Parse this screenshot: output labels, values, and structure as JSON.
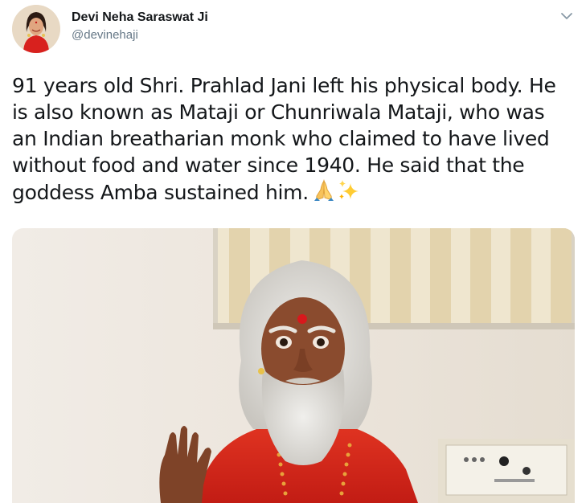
{
  "tweet": {
    "author": {
      "display_name": "Devi Neha Saraswat Ji",
      "handle": "@devinehaji",
      "avatar_icon": "profile-photo"
    },
    "caret_icon": "chevron-down-icon",
    "text_lines": [
      "91 years old Shri. Prahlad Jani left his physical body. He",
      "is also known as Mataji or Chunriwala Mataji, who was",
      "an Indian breatharian monk who claimed to have lived",
      "without food and water since 1940. He said that the",
      "goddess Amba sustained him."
    ],
    "emojis": [
      "folded-hands-icon",
      "sparkles-icon"
    ],
    "media": {
      "kind": "photo",
      "colors": {
        "wall": "#eee8e0",
        "robe": "#d9261c",
        "hair": "#d8d6d2",
        "skin": "#8a4b2e",
        "tilak": "#d8181c",
        "blinds": "#e9dcc0",
        "switchboard": "#f4f1e8"
      }
    },
    "colors": {
      "text": "#14171a",
      "secondary": "#657786",
      "avatar_bg": "#f0c9a8",
      "avatar_dress": "#d8211e"
    }
  }
}
